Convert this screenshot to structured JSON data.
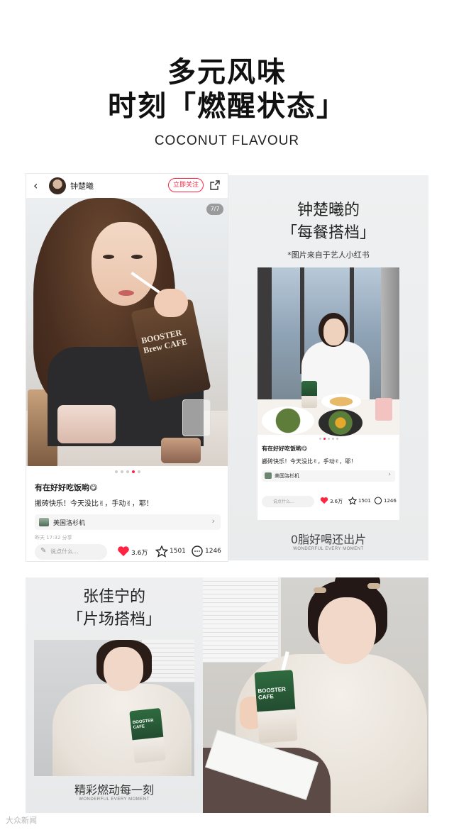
{
  "header": {
    "title_line1": "多元风味",
    "title_line2": "时刻「燃醒状态」",
    "subtitle": "COCONUT FLAVOUR"
  },
  "left_post": {
    "back_icon": "chevron-left-icon",
    "username": "钟楚曦",
    "follow_label": "立即关注",
    "share_icon": "share-icon",
    "page_indicator": "7/7",
    "pouch_text": "BOOSTER Brew CAFE",
    "post_title": "有在好好吃饭哟😋",
    "post_body": "搬砖快乐！今天没比✌，手动✌，耶！",
    "location": "美国洛杉机",
    "timestamp": "昨天 17:32 分享",
    "comment_placeholder": "说点什么...",
    "likes": "3.6万",
    "stars": "1501",
    "comments": "1246",
    "accent_color": "#ff2442"
  },
  "right_card": {
    "title_line1": "钟楚曦的",
    "title_line2": "「每餐搭档」",
    "note": "*图片来自于艺人小红书",
    "inner_post": {
      "title": "有在好好吃饭哟😋",
      "body": "搬砖快乐！今天没比✌，手动✌，耶！",
      "location": "美国洛杉机",
      "comment_placeholder": "说点什么...",
      "likes": "3.6万",
      "stars": "1501",
      "comments": "1246"
    },
    "caption": "0脂好喝还出片",
    "caption_en": "WONDERFUL EVERY MOMENT"
  },
  "bottom_left_card": {
    "title_line1": "张佳宁的",
    "title_line2": "「片场搭档」",
    "pouch_text": "BOOSTER CAFE",
    "caption": "精彩燃动每一刻",
    "caption_en": "WONDERFUL EVERY MOMENT"
  },
  "bottom_right_photo": {
    "pouch_text": "BOOSTER CAFE"
  },
  "watermark": "大众新闻"
}
